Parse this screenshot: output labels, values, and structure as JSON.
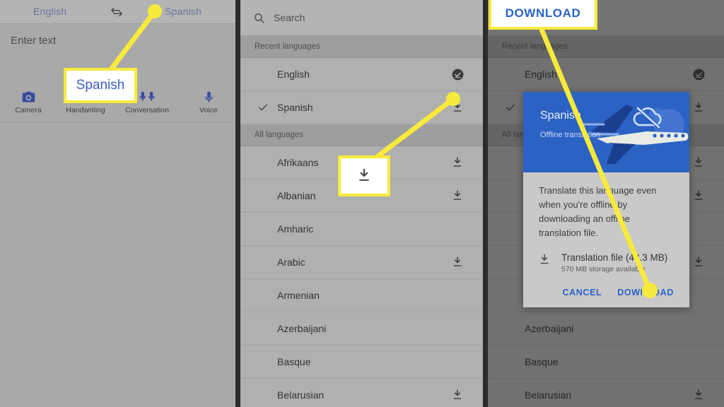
{
  "left_panel": {
    "source_language": "English",
    "target_language": "Spanish",
    "swap_icon": "swap-horizontal-icon",
    "input_placeholder": "Enter text",
    "tools": [
      {
        "label": "Camera",
        "icon": "camera-icon"
      },
      {
        "label": "Handwriting",
        "icon": "handwriting-icon"
      },
      {
        "label": "Conversation",
        "icon": "conversation-mics-icon"
      },
      {
        "label": "Voice",
        "icon": "microphone-icon"
      }
    ]
  },
  "language_picker": {
    "search_placeholder": "Search",
    "search_icon": "search-icon",
    "sections": [
      {
        "header": "Recent languages",
        "rows": [
          {
            "name": "English",
            "selected": false,
            "status": "downloaded"
          },
          {
            "name": "Spanish",
            "selected": true,
            "status": "download"
          }
        ]
      },
      {
        "header": "All languages",
        "rows": [
          {
            "name": "Afrikaans",
            "selected": false,
            "status": "download"
          },
          {
            "name": "Albanian",
            "selected": false,
            "status": "download"
          },
          {
            "name": "Amharic",
            "selected": false,
            "status": "none"
          },
          {
            "name": "Arabic",
            "selected": false,
            "status": "download"
          },
          {
            "name": "Armenian",
            "selected": false,
            "status": "none"
          },
          {
            "name": "Azerbaijani",
            "selected": false,
            "status": "none"
          },
          {
            "name": "Basque",
            "selected": false,
            "status": "none"
          },
          {
            "name": "Belarusian",
            "selected": false,
            "status": "download"
          }
        ]
      }
    ]
  },
  "dialog": {
    "hero_title": "Spanish",
    "hero_subtitle": "Offline translation",
    "hero_icons": [
      "cloud-off-icon",
      "airplane-icon"
    ],
    "body_text": "Translate this language even when you're offline by downloading an offline translation file.",
    "file_icon": "download-icon",
    "file_label": "Translation file (43.3 MB)",
    "storage_label": "570 MB storage available",
    "cancel_label": "CANCEL",
    "download_label": "DOWNLOAD"
  },
  "annotations": {
    "callout_spanish": "Spanish",
    "callout_download_icon": "download-icon",
    "callout_download_button": "DOWNLOAD",
    "highlight_color": "#f7ea3c",
    "accent_blue": "#2a63c6"
  }
}
